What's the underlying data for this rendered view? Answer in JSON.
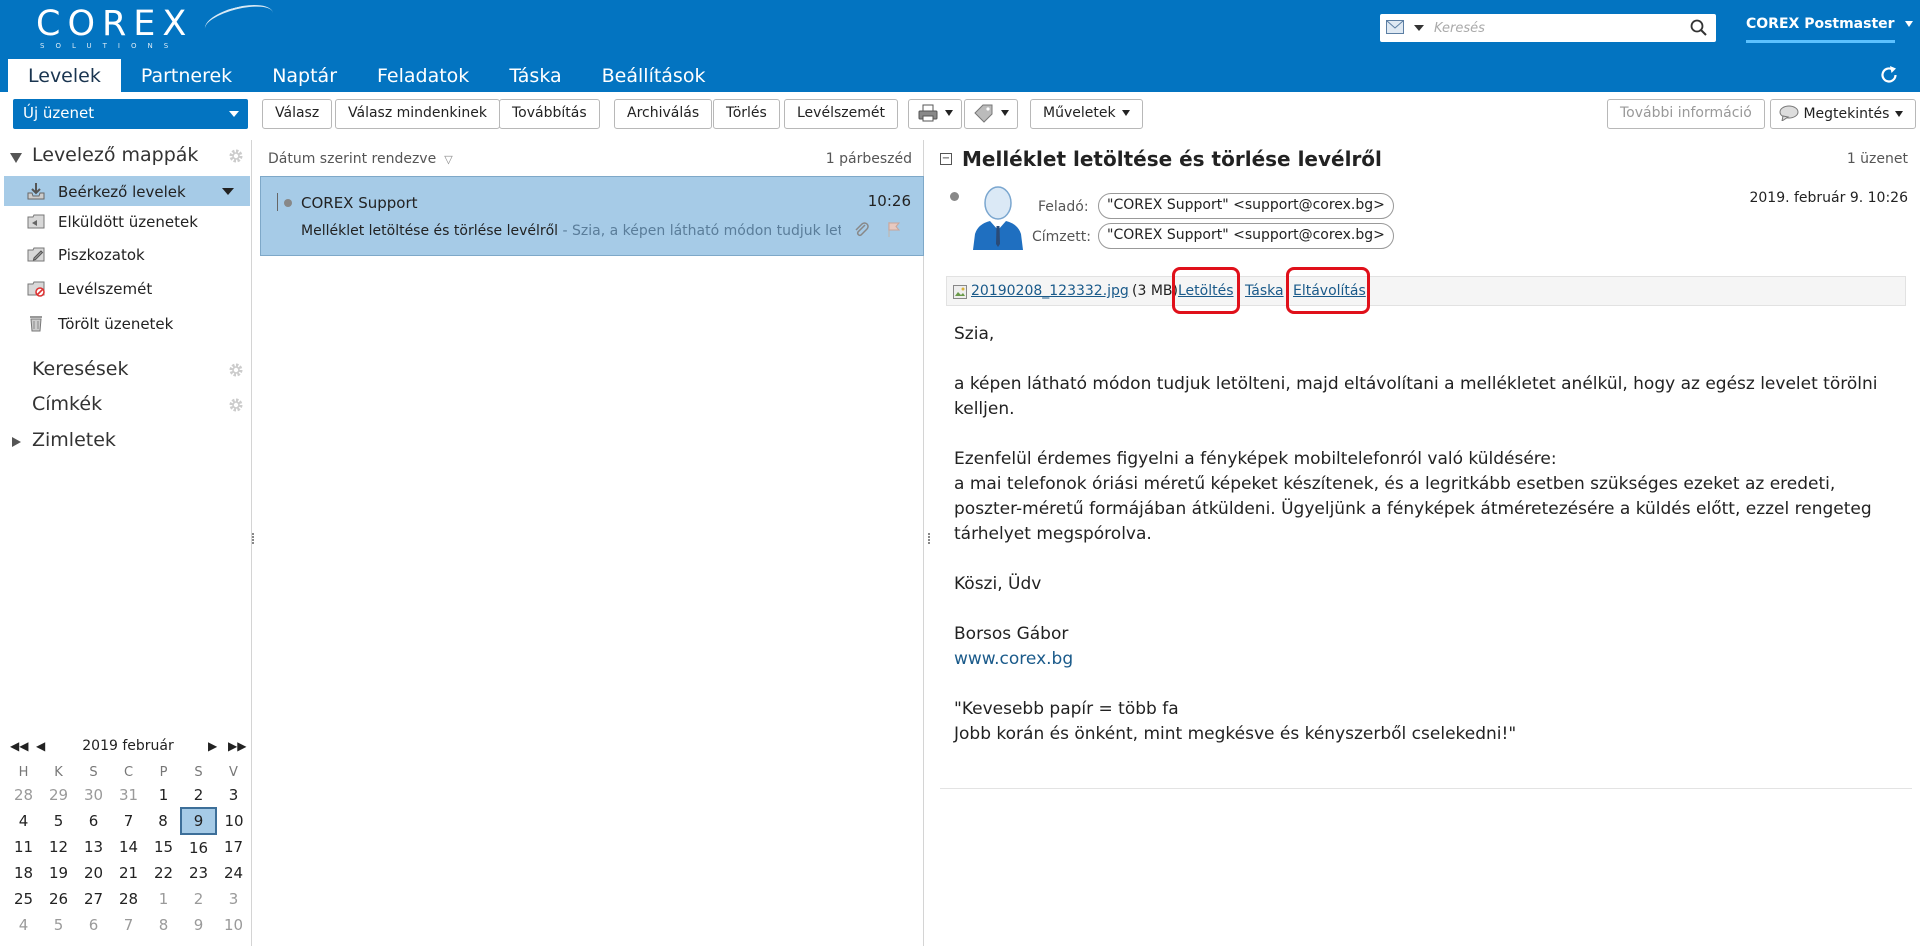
{
  "header": {
    "logo_text": "COREX",
    "logo_sub": "SOLUTIONS",
    "search_placeholder": "Keresés",
    "user_name": "COREX Postmaster",
    "colors": {
      "bar": "#0374c1",
      "selection": "#a6cbe7",
      "highlight_box": "#e0101a"
    }
  },
  "tabs": [
    "Levelek",
    "Partnerek",
    "Naptár",
    "Feladatok",
    "Táska",
    "Beállítások"
  ],
  "toolbar": {
    "new_message": "Új üzenet",
    "reply": "Válasz",
    "reply_all": "Válasz mindenkinek",
    "forward": "Továbbítás",
    "archive": "Archiválás",
    "delete": "Törlés",
    "spam": "Levélszemét",
    "actions": "Műveletek",
    "more_info": "További információ",
    "view": "Megtekintés"
  },
  "sidebar": {
    "mail_folders_title": "Levelező mappák",
    "folders": [
      {
        "label": "Beérkező levelek",
        "icon": "inbox-icon",
        "active": true
      },
      {
        "label": "Elküldött üzenetek",
        "icon": "sent-icon"
      },
      {
        "label": "Piszkozatok",
        "icon": "drafts-icon"
      },
      {
        "label": "Levélszemét",
        "icon": "spam-icon"
      },
      {
        "label": "Törölt üzenetek",
        "icon": "trash-icon"
      }
    ],
    "searches_title": "Keresések",
    "tags_title": "Címkék",
    "notes_title": "Zimletek"
  },
  "calendar": {
    "title": "2019 február",
    "weekdays": [
      "H",
      "K",
      "S",
      "C",
      "P",
      "S",
      "V"
    ],
    "weeks": [
      [
        {
          "d": "28",
          "o": true
        },
        {
          "d": "29",
          "o": true
        },
        {
          "d": "30",
          "o": true
        },
        {
          "d": "31",
          "o": true
        },
        {
          "d": "1"
        },
        {
          "d": "2"
        },
        {
          "d": "3"
        }
      ],
      [
        {
          "d": "4"
        },
        {
          "d": "5"
        },
        {
          "d": "6"
        },
        {
          "d": "7"
        },
        {
          "d": "8"
        },
        {
          "d": "9",
          "today": true
        },
        {
          "d": "10"
        }
      ],
      [
        {
          "d": "11"
        },
        {
          "d": "12"
        },
        {
          "d": "13"
        },
        {
          "d": "14"
        },
        {
          "d": "15"
        },
        {
          "d": "16"
        },
        {
          "d": "17"
        }
      ],
      [
        {
          "d": "18"
        },
        {
          "d": "19"
        },
        {
          "d": "20"
        },
        {
          "d": "21"
        },
        {
          "d": "22"
        },
        {
          "d": "23"
        },
        {
          "d": "24"
        }
      ],
      [
        {
          "d": "25"
        },
        {
          "d": "26"
        },
        {
          "d": "27"
        },
        {
          "d": "28"
        },
        {
          "d": "1",
          "o": true
        },
        {
          "d": "2",
          "o": true
        },
        {
          "d": "3",
          "o": true
        }
      ],
      [
        {
          "d": "4",
          "o": true
        },
        {
          "d": "5",
          "o": true
        },
        {
          "d": "6",
          "o": true
        },
        {
          "d": "7",
          "o": true
        },
        {
          "d": "8",
          "o": true
        },
        {
          "d": "9",
          "o": true
        },
        {
          "d": "10",
          "o": true
        }
      ]
    ]
  },
  "message_list": {
    "sort_label": "Dátum szerint rendezve",
    "count": "1 párbeszéd",
    "items": [
      {
        "sender": "COREX Support",
        "time": "10:26",
        "subject": "Melléklet letöltése és törlése levélről",
        "preview": " - Szia, a képen látható módon tudjuk letölteni, majd eltávolítani a mellékletet anélkül"
      }
    ]
  },
  "message": {
    "title": "Melléklet letöltése és törlése levélről",
    "count": "1 üzenet",
    "from_label": "Feladó:",
    "from": "\"COREX Support\" <support@corex.bg>",
    "to_label": "Címzett:",
    "to": "\"COREX Support\" <support@corex.bg>",
    "date": "2019. február 9. 10:26",
    "attachment": {
      "filename": "20190208_123332.jpg",
      "size": "(3 MB)",
      "download": "Letöltés",
      "briefcase": "Táska",
      "remove": "Eltávolítás"
    },
    "body": {
      "greeting": "Szia,",
      "p1": "a képen látható módon tudjuk letölteni, majd eltávolítani a mellékletet anélkül, hogy az egész levelet törölni kelljen.",
      "p2a": "Ezenfelül érdemes figyelni a fényképek mobiltelefonról való küldésére:",
      "p2b": "a mai telefonok óriási méretű képeket készítenek, és a legritkább esetben szükséges ezeket az eredeti, poszter-méretű formájában átküldeni. Ügyeljünk a fényképek átméretezésére a küldés előtt, ezzel rengeteg tárhelyet megspórolva.",
      "thanks": "Köszi, Üdv",
      "signature_name": "Borsos Gábor",
      "signature_url": "www.corex.bg",
      "quote1": "\"Kevesebb papír = több fa",
      "quote2": "Jobb korán és önként, mint megkésve és kényszerből cselekedni!\""
    }
  }
}
